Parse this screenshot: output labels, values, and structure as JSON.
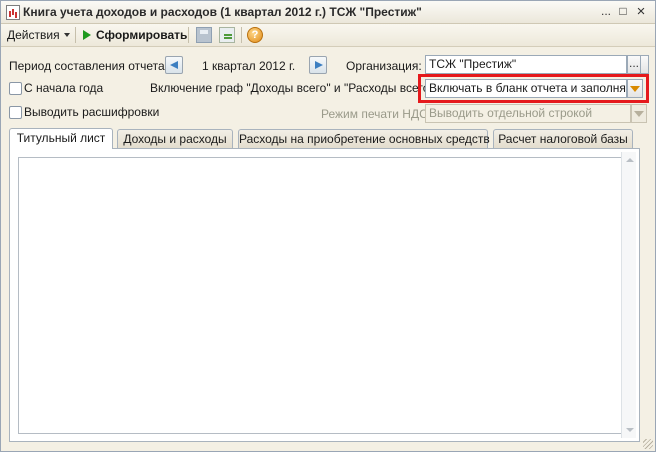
{
  "window": {
    "title": "Книга учета доходов и расходов (1 квартал 2012 г.) ТСЖ \"Престиж\"",
    "controls": {
      "menu": "...",
      "maximize": "□",
      "close": "×"
    }
  },
  "toolbar": {
    "actions_label": "Действия",
    "generate_label": "Сформировать",
    "help_glyph": "?"
  },
  "form": {
    "period_label": "Период составления отчета:",
    "period_value": "1 квартал 2012 г.",
    "organization_label": "Организация:",
    "organization_value": "ТСЖ \"Престиж\"",
    "organization_button": "...",
    "from_year_start_label": "С начала года",
    "include_columns_label": "Включение граф \"Доходы всего\" и \"Расходы всего\":",
    "include_columns_value": "Включать в бланк отчета и заполнять",
    "show_details_label": "Выводить расшифровки",
    "vat_mode_label": "Режим печати НДС:",
    "vat_mode_value": "Выводить отдельной строкой"
  },
  "tabs": [
    {
      "label": "Титульный лист",
      "active": true
    },
    {
      "label": "Доходы и расходы",
      "active": false
    },
    {
      "label": "Расходы на приобретение основных средств",
      "active": false
    },
    {
      "label": "Расчет налоговой базы",
      "active": false
    }
  ],
  "colors": {
    "highlight": "#e5191c",
    "generate_icon": "#1e9a1e",
    "nav_arrow": "#3d7fc1",
    "dropdown_arrow": "#d98a00"
  }
}
